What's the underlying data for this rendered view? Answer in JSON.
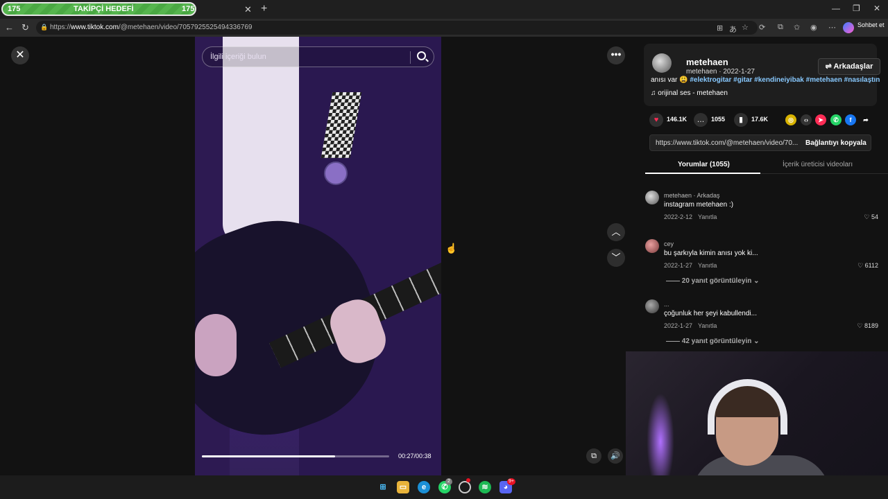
{
  "browser": {
    "goal_tab": {
      "left_count": "175",
      "title": "TAKİPÇİ HEDEFİ",
      "right_count": "175",
      "fill_fraction": 1.0
    },
    "url_prefix": "https://",
    "url_host": "www.tiktok.com",
    "url_path": "/@metehaen/video/7057925525494336769",
    "chat_label": "Sohbet et"
  },
  "video": {
    "search_placeholder": "İlgili içeriği bulun",
    "current_time": "00:27",
    "duration": "00:38",
    "time_display": "00:27/00:38",
    "progress_fraction": 0.71
  },
  "author": {
    "display_name": "metehaen",
    "subline": "metehaen · 2022-1-27",
    "friends_button": "⇌ Arkadaşlar",
    "description_text": "anısı var 😩 ",
    "hashtags": "#elektrogitar #gitar #kendineiyibak #metehaen #nasılaştın",
    "sound": "♫  orijinal ses - metehaen"
  },
  "stats": {
    "likes": "146.1K",
    "comments": "1055",
    "saves": "17.6K"
  },
  "share": {
    "link_text": "https://www.tiktok.com/@metehaen/video/70...",
    "copy_label": "Bağlantıyı kopyala"
  },
  "tabs": {
    "comments": "Yorumlar (1055)",
    "creator_videos": "İçerik üreticisi videoları"
  },
  "comments": [
    {
      "name": "metehaen · Arkadaş",
      "text": "instagram metehaen :)",
      "date": "2022-2-12",
      "reply": "Yanıtla",
      "likes": "♡ 54",
      "views": ""
    },
    {
      "name": "cey",
      "text": "bu şarkıyla kimin anısı yok ki...",
      "date": "2022-1-27",
      "reply": "Yanıtla",
      "likes": "♡ 6112",
      "views": "—— 20 yanıt görüntüleyin ⌄"
    },
    {
      "name": "...",
      "text": "çoğunluk her şeyi kabullendi...",
      "date": "2022-1-27",
      "reply": "Yanıtla",
      "likes": "♡ 8189",
      "views": "—— 42 yanıt görüntüleyin ⌄"
    }
  ],
  "colors": {
    "like_heart": "#fe2c55",
    "hashtag": "#88c9ff",
    "goal_green": "#4aa843"
  },
  "taskbar": {
    "whatsapp_badge": "2",
    "discord_badge": "9+"
  }
}
